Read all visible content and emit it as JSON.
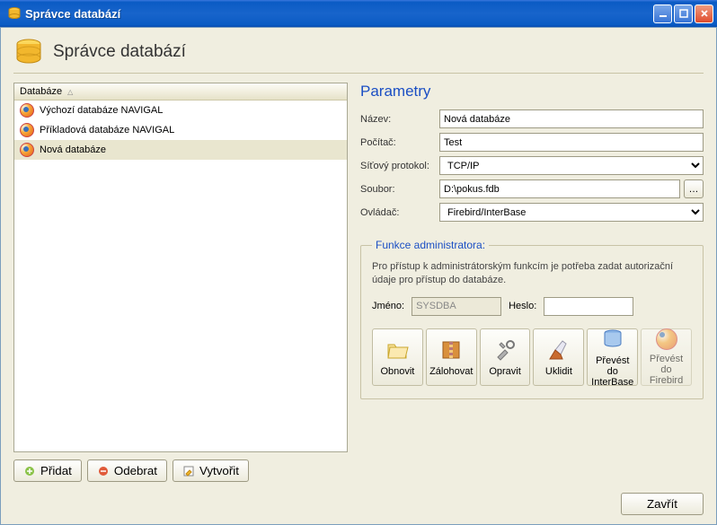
{
  "window": {
    "title": "Správce databází"
  },
  "header": {
    "title": "Správce databází"
  },
  "db_list": {
    "header": "Databáze",
    "items": [
      {
        "label": "Výchozí databáze NAVIGAL"
      },
      {
        "label": "Příkladová databáze NAVIGAL"
      },
      {
        "label": "Nová databáze"
      }
    ],
    "selected_index": 2
  },
  "left_buttons": {
    "add": "Přidat",
    "remove": "Odebrat",
    "create": "Vytvořit"
  },
  "params": {
    "title": "Parametry",
    "labels": {
      "name": "Název:",
      "host": "Počítač:",
      "protocol": "Síťový protokol:",
      "file": "Soubor:",
      "driver": "Ovládač:"
    },
    "values": {
      "name": "Nová databáze",
      "host": "Test",
      "protocol": "TCP/IP",
      "file": "D:\\pokus.fdb",
      "driver": "Firebird/InterBase"
    }
  },
  "admin": {
    "legend": "Funkce administratora:",
    "desc": "Pro přístup k administrátorským funkcím je potřeba zadat autorizační údaje pro přístup do databáze.",
    "username_label": "Jméno:",
    "username_value": "SYSDBA",
    "password_label": "Heslo:",
    "password_value": "",
    "tools": {
      "restore": "Obnovit",
      "backup": "Zálohovat",
      "repair": "Opravit",
      "clean": "Uklidit",
      "to_ib": "Převést do InterBase",
      "to_fb": "Převést do Firebird"
    }
  },
  "footer": {
    "close": "Zavřít"
  }
}
